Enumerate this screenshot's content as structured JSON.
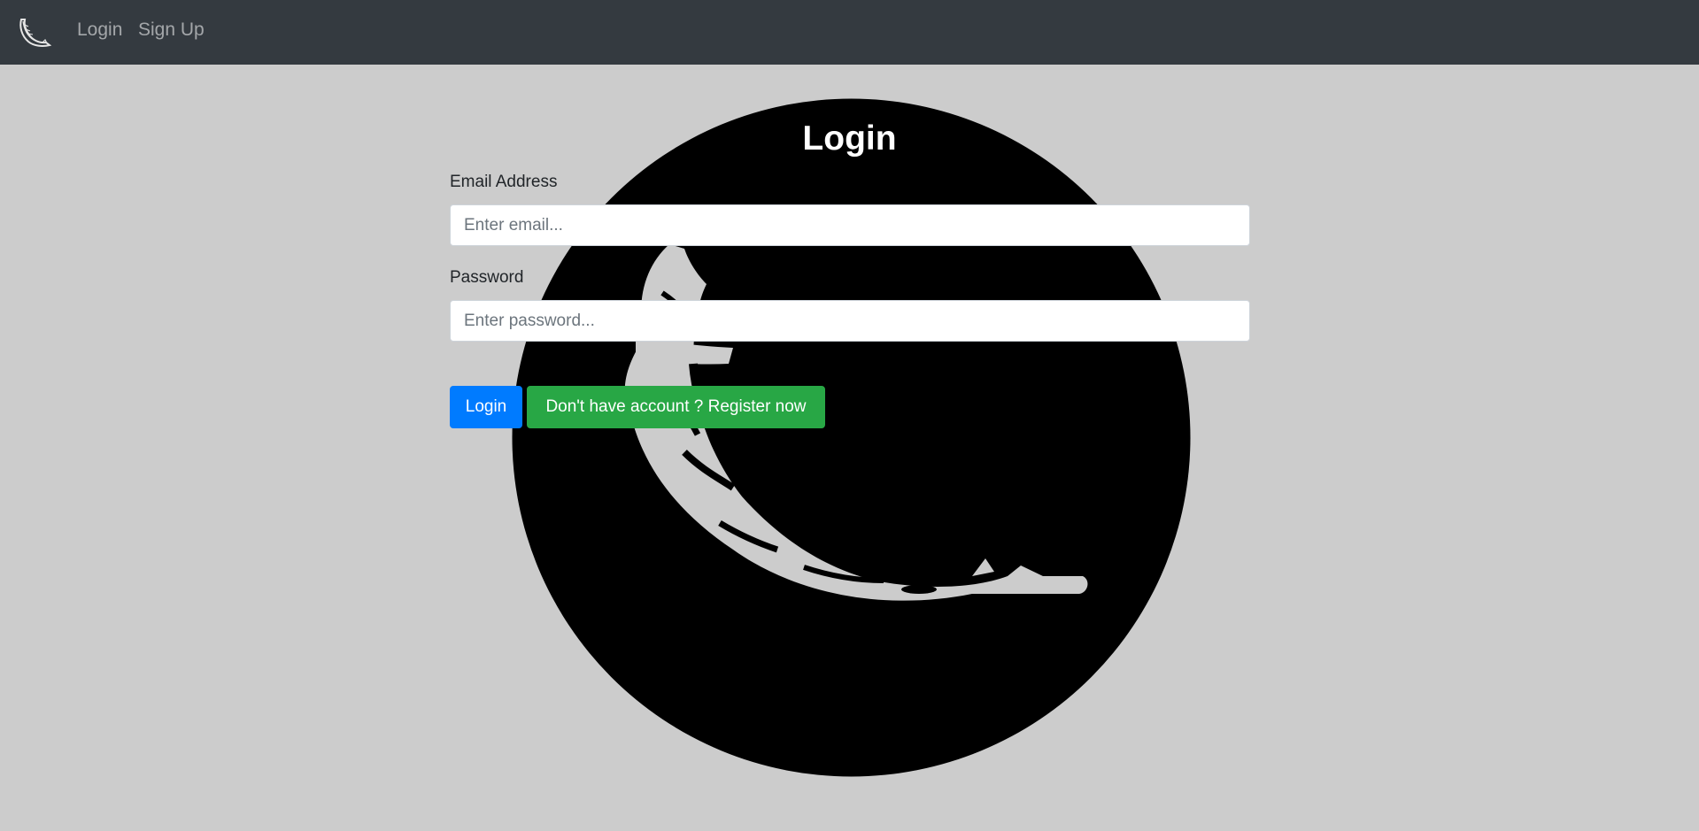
{
  "navbar": {
    "brand_icon": "flask-logo-icon",
    "links": [
      {
        "label": "Login"
      },
      {
        "label": "Sign Up"
      }
    ],
    "colors": {
      "background": "#343a40",
      "link": "rgba(255,255,255,0.55)"
    }
  },
  "background": {
    "logo_icon": "flask-logo-circle-icon",
    "page_color": "#cccccc"
  },
  "form": {
    "title": "Login",
    "email": {
      "label": "Email Address",
      "placeholder": "Enter email..."
    },
    "password": {
      "label": "Password",
      "placeholder": "Enter password..."
    },
    "login_button": "Login",
    "register_button": "Don't have account ? Register now",
    "colors": {
      "login_button": "#007bff",
      "register_button": "#28a745"
    }
  }
}
